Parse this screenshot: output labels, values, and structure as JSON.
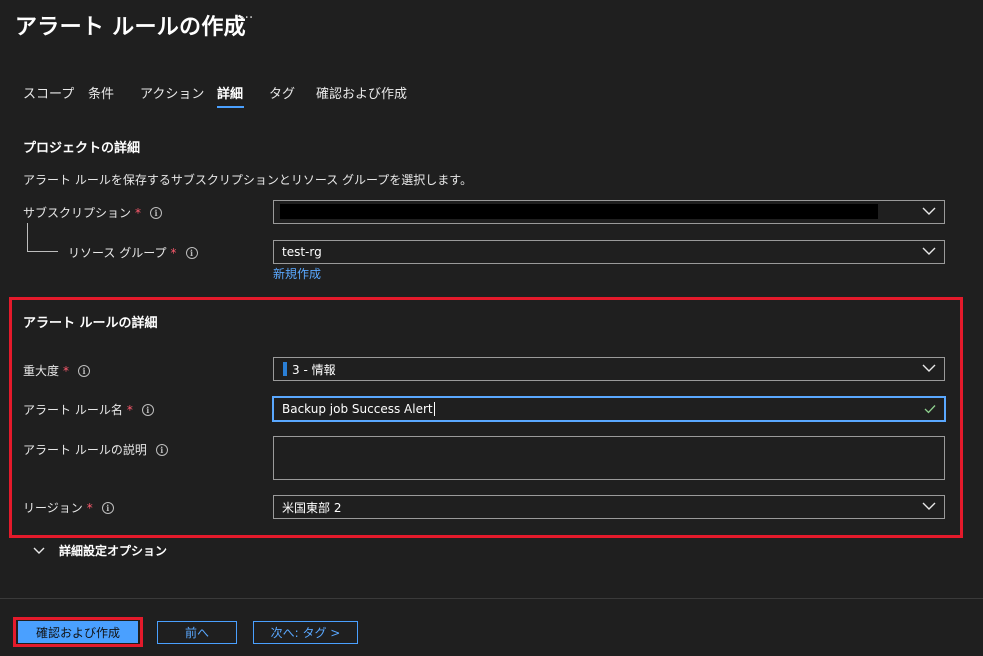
{
  "header": {
    "title": "アラート ルールの作成",
    "more": "···"
  },
  "tabs": [
    {
      "label": "スコープ"
    },
    {
      "label": "条件"
    },
    {
      "label": "アクション"
    },
    {
      "label": "詳細",
      "active": true
    },
    {
      "label": "タグ"
    },
    {
      "label": "確認および作成"
    }
  ],
  "project": {
    "title": "プロジェクトの詳細",
    "description": "アラート ルールを保存するサブスクリプションとリソース グループを選択します。",
    "subscription": {
      "label": "サブスクリプション",
      "required": "*",
      "value": ""
    },
    "resource_group": {
      "label": "リソース グループ",
      "required": "*",
      "value": "test-rg",
      "new_link": "新規作成"
    }
  },
  "alert_details": {
    "title": "アラート ルールの詳細",
    "severity": {
      "label": "重大度",
      "required": "*",
      "value": "3 - 情報"
    },
    "rule_name": {
      "label": "アラート ルール名",
      "required": "*",
      "value": "Backup job Success Alert"
    },
    "rule_description": {
      "label": "アラート ルールの説明",
      "value": ""
    },
    "region": {
      "label": "リージョン",
      "required": "*",
      "value": "米国東部 2"
    }
  },
  "advanced": {
    "label": "詳細設定オプション"
  },
  "footer": {
    "review_create": "確認および作成",
    "previous": "前へ",
    "next": "次へ: タグ >"
  },
  "colors": {
    "accent": "#4aa0ff",
    "highlight_box": "#e41a2b",
    "required": "#ff5b6e",
    "background": "#1f1f1f"
  },
  "icons": [
    "info-icon",
    "chevron-down-icon",
    "checkmark-icon",
    "more-icon"
  ]
}
